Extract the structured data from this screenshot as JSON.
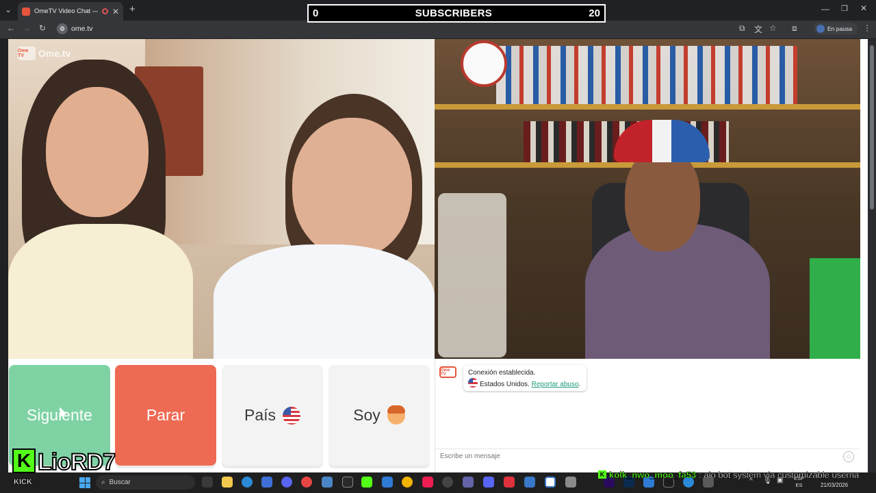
{
  "browser": {
    "tab_title": "OmeTV Video Chat — Ome",
    "url": "ome.tv",
    "profile_status": "En pausa"
  },
  "overlay": {
    "score_left": "0",
    "score_label": "SUBSCRIBERS",
    "score_right": "20",
    "streamer_name": "LioRD7",
    "kick_label": "KICK",
    "ticker_user": "kolk_nwo_moo_fa53",
    "ticker_message": ": aio bot system via customizable userna"
  },
  "video": {
    "logo_text": "Ome.tv",
    "logo_badge": "Ome TV"
  },
  "controls": {
    "next_label": "Siguiente",
    "stop_label": "Parar",
    "country_label": "País",
    "gender_label": "Soy"
  },
  "chat": {
    "avatar_badge": "Ome TV",
    "connection_message": "Conexión establecida.",
    "country_text": "Estados Unidos.",
    "report_link": "Reportar abuso",
    "report_suffix": ".",
    "input_placeholder": "Escribe un mensaje"
  },
  "taskbar": {
    "search_placeholder": "Buscar",
    "lang_top": "ESP",
    "lang_bottom": "ES",
    "date": "21/03/2026"
  },
  "colors": {
    "next": "#7fd2a4",
    "stop": "#ee6a53",
    "neutral_button": "#f3f3f3",
    "kick_green": "#53fc18",
    "ome_orange": "#e8533c",
    "link": "#1c9a7c"
  },
  "icons": [
    "tab-menu-icon",
    "close-icon",
    "plus-icon",
    "back-arrow-icon",
    "forward-arrow-icon",
    "reload-icon",
    "site-info-icon",
    "cast-icon",
    "translate-icon",
    "star-icon",
    "extensions-icon",
    "kebab-menu-icon",
    "us-flag-icon",
    "boy-emoji-icon",
    "emoji-icon",
    "windows-start-icon",
    "search-icon"
  ]
}
